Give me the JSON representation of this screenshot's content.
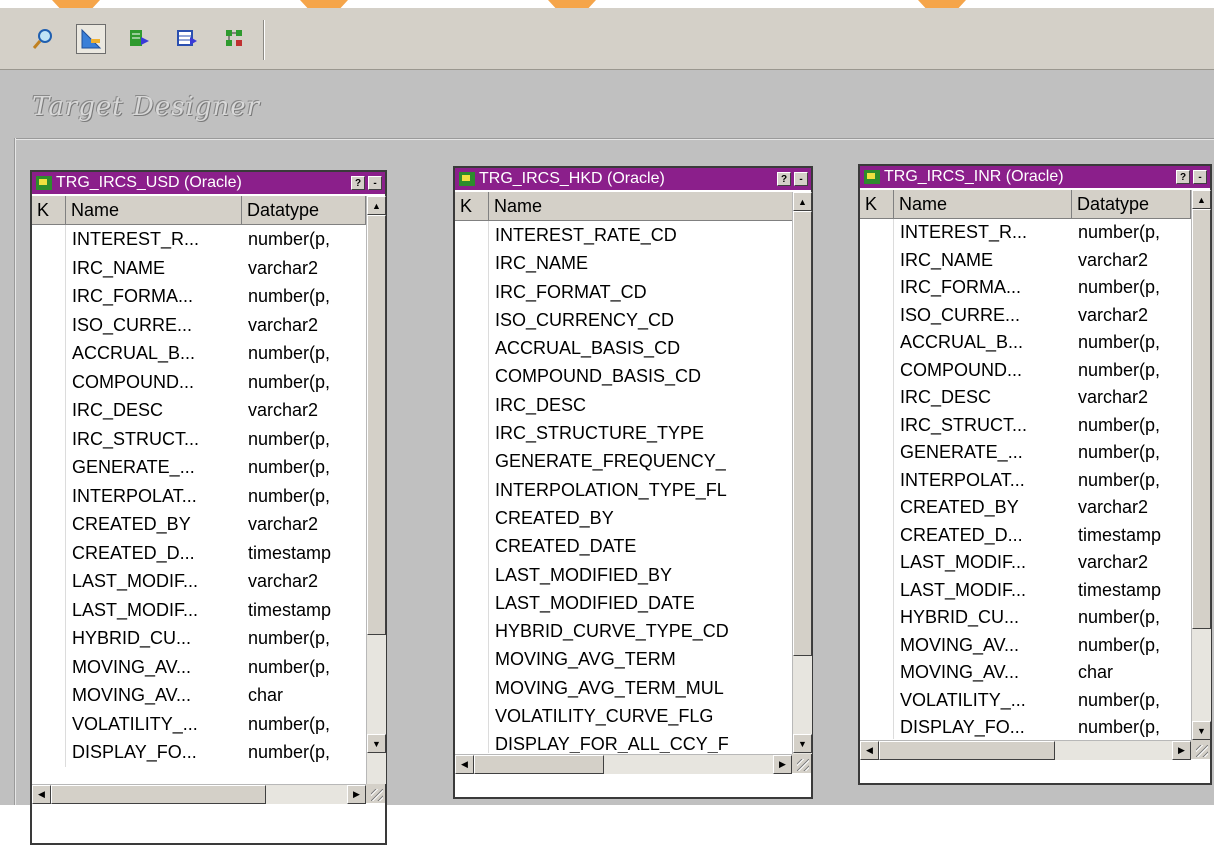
{
  "toolbar": {
    "buttons": [
      {
        "name": "source-analyzer-icon",
        "active": false
      },
      {
        "name": "target-designer-icon",
        "active": true
      },
      {
        "name": "transformation-developer-icon",
        "active": false
      },
      {
        "name": "mapplet-designer-icon",
        "active": false
      },
      {
        "name": "mapping-designer-icon",
        "active": false
      }
    ]
  },
  "workspace": {
    "title": "Target Designer"
  },
  "tables": [
    {
      "title": "TRG_IRCS_USD (Oracle)",
      "help": "?",
      "minimize": "-",
      "headers": {
        "k": "K",
        "name": "Name",
        "datatype": "Datatype"
      },
      "rows": [
        {
          "name": "INTEREST_R...",
          "type": "number(p,"
        },
        {
          "name": "IRC_NAME",
          "type": "varchar2"
        },
        {
          "name": "IRC_FORMA...",
          "type": "number(p,"
        },
        {
          "name": "ISO_CURRE...",
          "type": "varchar2"
        },
        {
          "name": "ACCRUAL_B...",
          "type": "number(p,"
        },
        {
          "name": "COMPOUND...",
          "type": "number(p,"
        },
        {
          "name": "IRC_DESC",
          "type": "varchar2"
        },
        {
          "name": "IRC_STRUCT...",
          "type": "number(p,"
        },
        {
          "name": "GENERATE_...",
          "type": "number(p,"
        },
        {
          "name": "INTERPOLAT...",
          "type": "number(p,"
        },
        {
          "name": "CREATED_BY",
          "type": "varchar2"
        },
        {
          "name": "CREATED_D...",
          "type": "timestamp"
        },
        {
          "name": "LAST_MODIF...",
          "type": "varchar2"
        },
        {
          "name": "LAST_MODIF...",
          "type": "timestamp"
        },
        {
          "name": "HYBRID_CU...",
          "type": "number(p,"
        },
        {
          "name": "MOVING_AV...",
          "type": "number(p,"
        },
        {
          "name": "MOVING_AV...",
          "type": "char"
        },
        {
          "name": "VOLATILITY_...",
          "type": "number(p,"
        },
        {
          "name": "DISPLAY_FO...",
          "type": "number(p,"
        }
      ]
    },
    {
      "title": "TRG_IRCS_HKD (Oracle)",
      "help": "?",
      "minimize": "-",
      "headers": {
        "k": "K",
        "name": "Name"
      },
      "rows": [
        {
          "name": "INTEREST_RATE_CD"
        },
        {
          "name": "IRC_NAME"
        },
        {
          "name": "IRC_FORMAT_CD"
        },
        {
          "name": "ISO_CURRENCY_CD"
        },
        {
          "name": "ACCRUAL_BASIS_CD"
        },
        {
          "name": "COMPOUND_BASIS_CD"
        },
        {
          "name": "IRC_DESC"
        },
        {
          "name": "IRC_STRUCTURE_TYPE"
        },
        {
          "name": "GENERATE_FREQUENCY_"
        },
        {
          "name": "INTERPOLATION_TYPE_FL"
        },
        {
          "name": "CREATED_BY"
        },
        {
          "name": "CREATED_DATE"
        },
        {
          "name": "LAST_MODIFIED_BY"
        },
        {
          "name": "LAST_MODIFIED_DATE"
        },
        {
          "name": "HYBRID_CURVE_TYPE_CD"
        },
        {
          "name": "MOVING_AVG_TERM"
        },
        {
          "name": "MOVING_AVG_TERM_MUL"
        },
        {
          "name": "VOLATILITY_CURVE_FLG"
        },
        {
          "name": "DISPLAY_FOR_ALL_CCY_F"
        }
      ]
    },
    {
      "title": "TRG_IRCS_INR (Oracle)",
      "help": "?",
      "minimize": "-",
      "headers": {
        "k": "K",
        "name": "Name",
        "datatype": "Datatype"
      },
      "rows": [
        {
          "name": "INTEREST_R...",
          "type": "number(p,"
        },
        {
          "name": "IRC_NAME",
          "type": "varchar2"
        },
        {
          "name": "IRC_FORMA...",
          "type": "number(p,"
        },
        {
          "name": "ISO_CURRE...",
          "type": "varchar2"
        },
        {
          "name": "ACCRUAL_B...",
          "type": "number(p,"
        },
        {
          "name": "COMPOUND...",
          "type": "number(p,"
        },
        {
          "name": "IRC_DESC",
          "type": "varchar2"
        },
        {
          "name": "IRC_STRUCT...",
          "type": "number(p,"
        },
        {
          "name": "GENERATE_...",
          "type": "number(p,"
        },
        {
          "name": "INTERPOLAT...",
          "type": "number(p,"
        },
        {
          "name": "CREATED_BY",
          "type": "varchar2"
        },
        {
          "name": "CREATED_D...",
          "type": "timestamp"
        },
        {
          "name": "LAST_MODIF...",
          "type": "varchar2"
        },
        {
          "name": "LAST_MODIF...",
          "type": "timestamp"
        },
        {
          "name": "HYBRID_CU...",
          "type": "number(p,"
        },
        {
          "name": "MOVING_AV...",
          "type": "number(p,"
        },
        {
          "name": "MOVING_AV...",
          "type": "char"
        },
        {
          "name": "VOLATILITY_...",
          "type": "number(p,"
        },
        {
          "name": "DISPLAY_FO...",
          "type": "number(p,"
        }
      ]
    }
  ]
}
